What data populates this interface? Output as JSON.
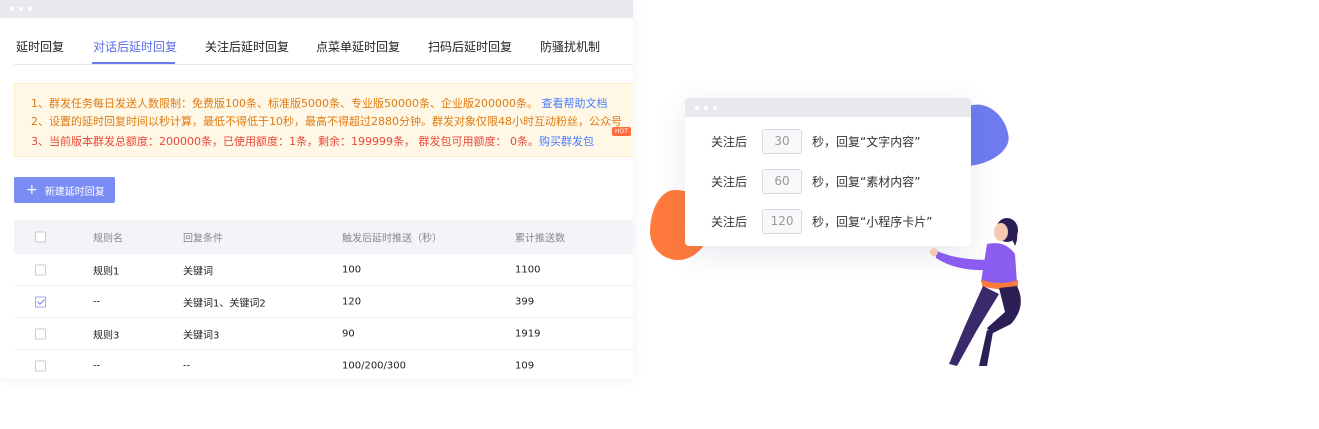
{
  "window": {
    "dots": 3
  },
  "tabs": [
    {
      "label": "延时回复",
      "active": false
    },
    {
      "label": "对话后延时回复",
      "active": true
    },
    {
      "label": "关注后延时回复",
      "active": false
    },
    {
      "label": "点菜单延时回复",
      "active": false
    },
    {
      "label": "扫码后延时回复",
      "active": false
    },
    {
      "label": "防骚扰机制",
      "active": false
    }
  ],
  "notice": {
    "line1": "1、群发任务每日发送人数限制：免费版100条、标准版5000条、专业版50000条、企业版200000条。",
    "line1_link": "查看帮助文档",
    "line2": "2、设置的延时回复时间以秒计算，最低不得低于10秒，最高不得超过2880分钟。群发对象仅限48小时互动粉丝，公众号",
    "line3": "3、当前版本群发总额度：200000条，已使用额度：1条，剩余：199999条， 群发包可用额度： 0条。",
    "line3_link": "购买群发包",
    "hot_badge": "HOT"
  },
  "new_button": {
    "icon": "plus-icon",
    "label": "新建延时回复"
  },
  "table": {
    "headers": [
      "规则名",
      "回复条件",
      "触发后延时推送（秒）",
      "累计推送数"
    ],
    "rows": [
      {
        "checked": false,
        "name": "规则1",
        "condition": "关键词",
        "delay": "100",
        "count": "1100"
      },
      {
        "checked": true,
        "name": "--",
        "condition": "关键词1、关键词2",
        "delay": "120",
        "count": "399"
      },
      {
        "checked": false,
        "name": "规则3",
        "condition": "关键词3",
        "delay": "90",
        "count": "1919"
      },
      {
        "checked": false,
        "name": "--",
        "condition": "--",
        "delay": "100/200/300",
        "count": "109"
      }
    ]
  },
  "card": {
    "rows": [
      {
        "prefix": "关注后",
        "value": "30",
        "suffix": "秒，回复“文字内容”"
      },
      {
        "prefix": "关注后",
        "value": "60",
        "suffix": "秒，回复“素材内容”"
      },
      {
        "prefix": "关注后",
        "value": "120",
        "suffix": "秒，回复“小程序卡片”"
      }
    ]
  },
  "colors": {
    "accent": "#6b7cf0",
    "warning": "#e07a12",
    "danger": "#e8493a",
    "link": "#4a7cff",
    "blob_orange": "#ff7a3c"
  }
}
